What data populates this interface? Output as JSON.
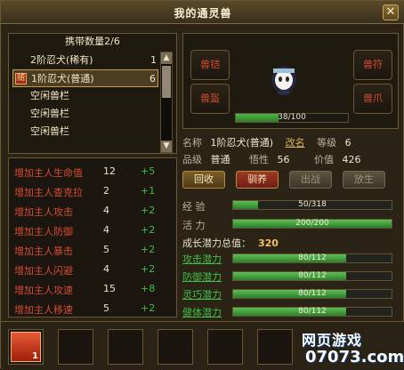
{
  "window": {
    "title": "我的通灵兽",
    "close_label": "✕"
  },
  "list": {
    "carry_label": "携带数量2/6",
    "items": [
      {
        "name": "2阶忍犬(稀有)",
        "count": "1",
        "selected": false,
        "flag": ""
      },
      {
        "name": "1阶忍犬(普通)",
        "count": "6",
        "selected": true,
        "flag": "随"
      },
      {
        "name": "空闲兽栏",
        "count": "",
        "selected": false,
        "flag": ""
      },
      {
        "name": "空闲兽栏",
        "count": "",
        "selected": false,
        "flag": ""
      },
      {
        "name": "空闲兽栏",
        "count": "",
        "selected": false,
        "flag": ""
      }
    ]
  },
  "stats": [
    {
      "label": "增加主人生命值",
      "level": "12",
      "plus": "+5"
    },
    {
      "label": "增加主人查克拉",
      "level": "2",
      "plus": "+1"
    },
    {
      "label": "增加主人攻击",
      "level": "4",
      "plus": "+2"
    },
    {
      "label": "增加主人防御",
      "level": "4",
      "plus": "+2"
    },
    {
      "label": "增加主人暴击",
      "level": "5",
      "plus": "+2"
    },
    {
      "label": "增加主人闪避",
      "level": "4",
      "plus": "+2"
    },
    {
      "label": "增加主人攻速",
      "level": "15",
      "plus": "+8"
    },
    {
      "label": "增加主人移速",
      "level": "5",
      "plus": "+2"
    }
  ],
  "equip": {
    "slot1": "兽铠",
    "slot2": "兽盔",
    "slot3": "兽符",
    "slot4": "兽爪",
    "hp_text": "38/100",
    "hp_value": 0.38
  },
  "info": {
    "name_label": "名称",
    "name_value": "1阶忍犬(普通)",
    "rename_label": "改名",
    "level_label": "等级",
    "level_value": "6",
    "quality_label": "品级",
    "quality_value": "普通",
    "aptitude_label": "悟性",
    "aptitude_value": "56",
    "price_label": "价值",
    "price_value": "426"
  },
  "actions": {
    "recycle": "回收",
    "train": "驯养",
    "battle": "出战",
    "release": "放生"
  },
  "bars": {
    "exp_label": "经  验",
    "exp_text": "50/318",
    "exp_value": 0.157,
    "vital_label": "活  力",
    "vital_text": "200/200",
    "vital_value": 1.0
  },
  "growth": {
    "label": "成长潜力总值：",
    "value": "320",
    "items": [
      {
        "label": "攻击潜力",
        "text": "80/112",
        "value": 0.714
      },
      {
        "label": "防御潜力",
        "text": "80/112",
        "value": 0.714
      },
      {
        "label": "灵巧潜力",
        "text": "80/112",
        "value": 0.714
      },
      {
        "label": "健体潜力",
        "text": "80/112",
        "value": 0.714
      }
    ]
  },
  "skillbar": {
    "first_skill_count": "1",
    "watermark_line1": "网页游戏",
    "watermark_line2": "07073.com"
  }
}
